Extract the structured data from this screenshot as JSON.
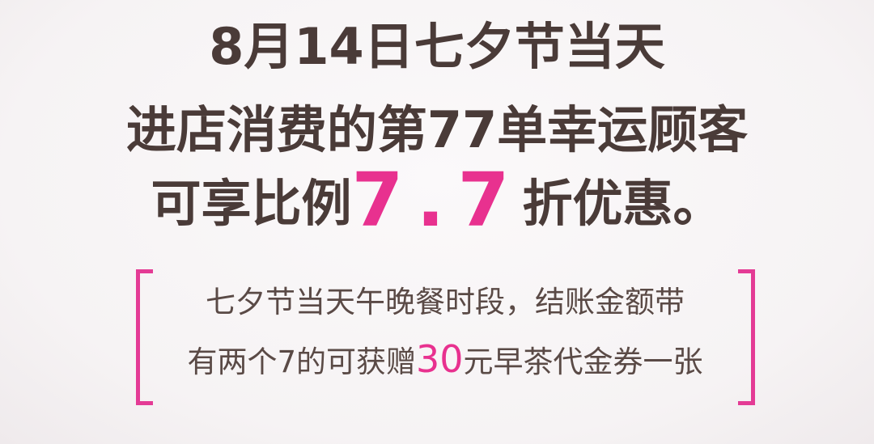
{
  "headline": {
    "line1": "8月14日七夕节当天",
    "line2": "进店消费的第77单幸运顾客",
    "line3_prefix": "可享比例",
    "line3_highlight": "7.7",
    "line3_suffix": "折优惠。"
  },
  "offer": {
    "line1": "七夕节当天午晚餐时段，结账金额带",
    "line2_prefix": "有两个7的可获赠",
    "line2_highlight": "30",
    "line2_suffix": "元早茶代金券一张"
  },
  "colors": {
    "text": "#4a3b38",
    "accent": "#e8318f",
    "bracket": "#e43b95"
  }
}
